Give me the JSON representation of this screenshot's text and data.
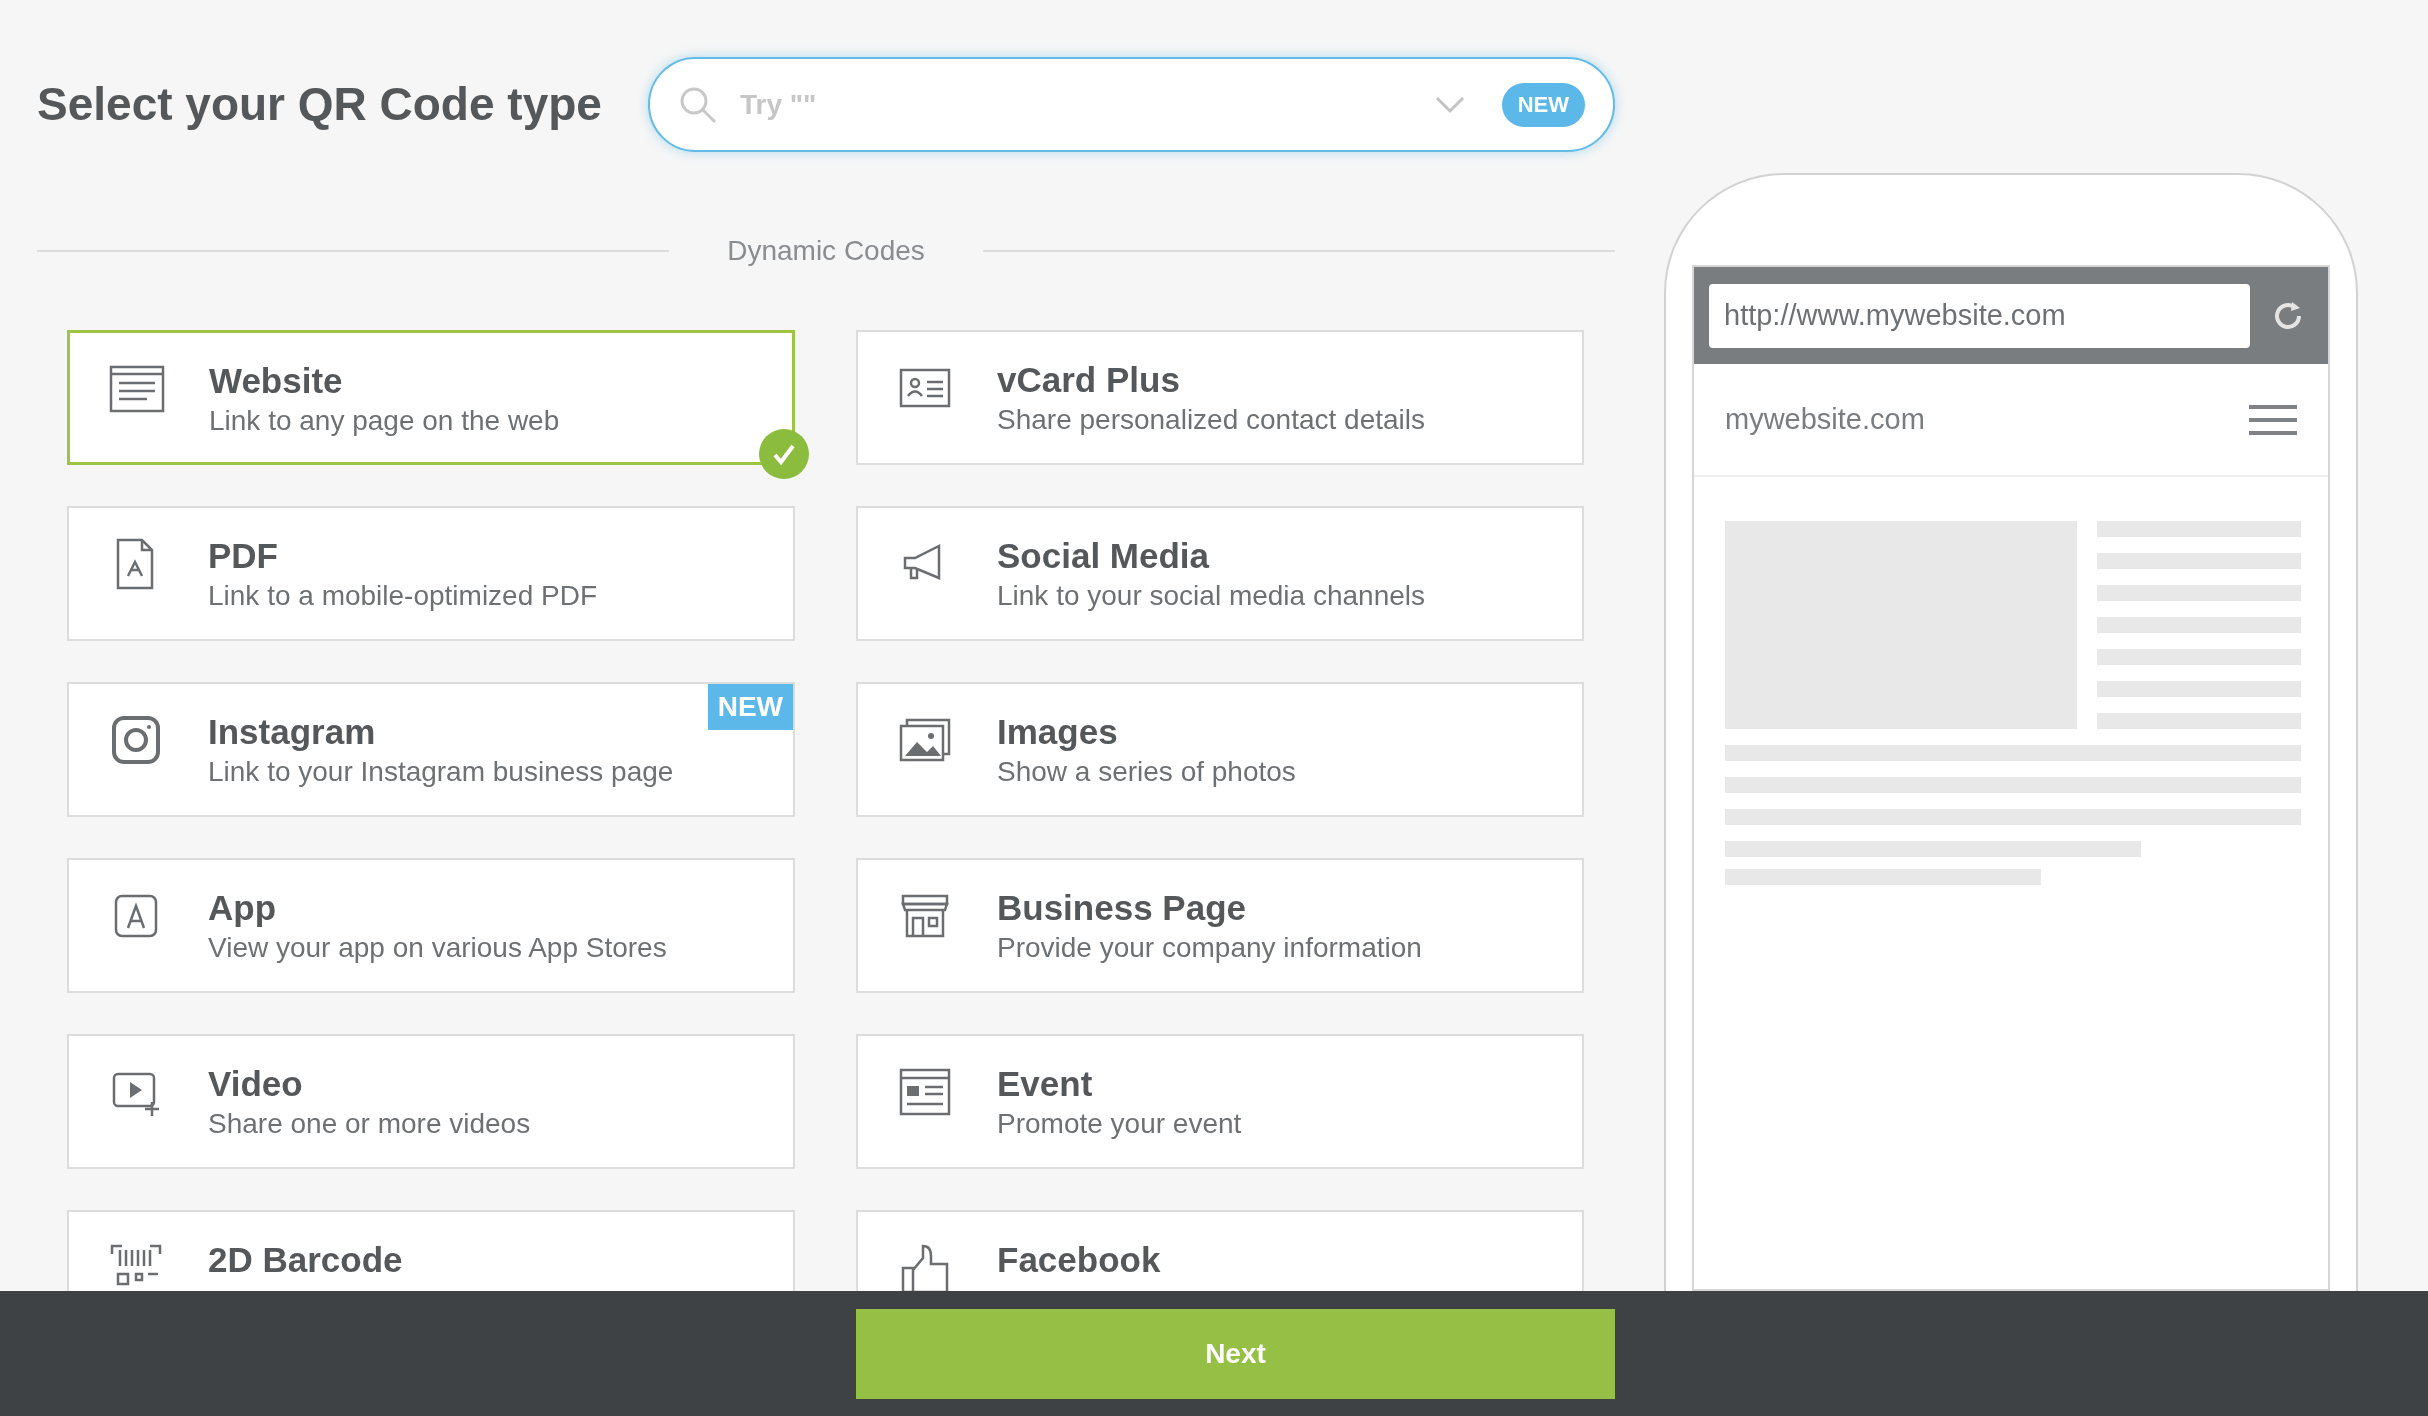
{
  "title": "Select your QR Code type",
  "search": {
    "placeholder": "Try \"\"",
    "badge": "NEW"
  },
  "section": "Dynamic Codes",
  "cards": [
    {
      "title": "Website",
      "description": "Link to any page on the web",
      "selected": true
    },
    {
      "title": "vCard Plus",
      "description": "Share personalized contact details",
      "selected": false
    },
    {
      "title": "PDF",
      "description": "Link to a mobile-optimized PDF",
      "selected": false
    },
    {
      "title": "Social Media",
      "description": "Link to your social media channels",
      "selected": false
    },
    {
      "title": "Instagram",
      "description": "Link to your Instagram business page",
      "selected": false,
      "badge": "NEW"
    },
    {
      "title": "Images",
      "description": "Show a series of photos",
      "selected": false
    },
    {
      "title": "App",
      "description": "View your app on various App Stores",
      "selected": false
    },
    {
      "title": "Business Page",
      "description": "Provide your company information",
      "selected": false
    },
    {
      "title": "Video",
      "description": "Share one or more videos",
      "selected": false
    },
    {
      "title": "Event",
      "description": "Promote your event",
      "selected": false
    },
    {
      "title": "2D Barcode",
      "selected": false
    },
    {
      "title": "Facebook",
      "selected": false
    }
  ],
  "preview": {
    "url": "http://www.mywebsite.com",
    "site": "mywebsite.com"
  },
  "next_button": "Next"
}
